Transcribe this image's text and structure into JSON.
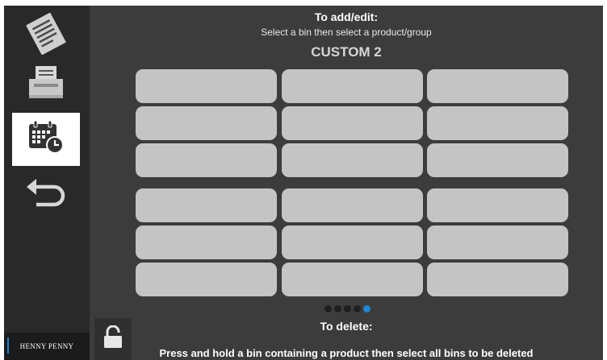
{
  "header": {
    "title": "To add/edit:",
    "instruction": "Select a bin then select a product/group",
    "group_name": "CUSTOM 2"
  },
  "sidebar": {
    "items": [
      {
        "name": "document-icon",
        "active": false
      },
      {
        "name": "printer-icon",
        "active": false
      },
      {
        "name": "calendar-clock-icon",
        "active": true
      },
      {
        "name": "back-arrow-icon",
        "active": false
      }
    ],
    "brand": "HENNY PENNY",
    "brand_accent": "#1e7fcf"
  },
  "lock": {
    "icon": "unlock-icon"
  },
  "bins": {
    "rows": 6,
    "columns": 3,
    "count": 18,
    "color": "#c4c4c4"
  },
  "pagination": {
    "pages": 5,
    "current": 5,
    "active_color": "#1e86d8"
  },
  "footer": {
    "delete_title": "To delete:",
    "delete_instruction": "Press and hold a bin containing a product then select all bins to be deleted"
  }
}
